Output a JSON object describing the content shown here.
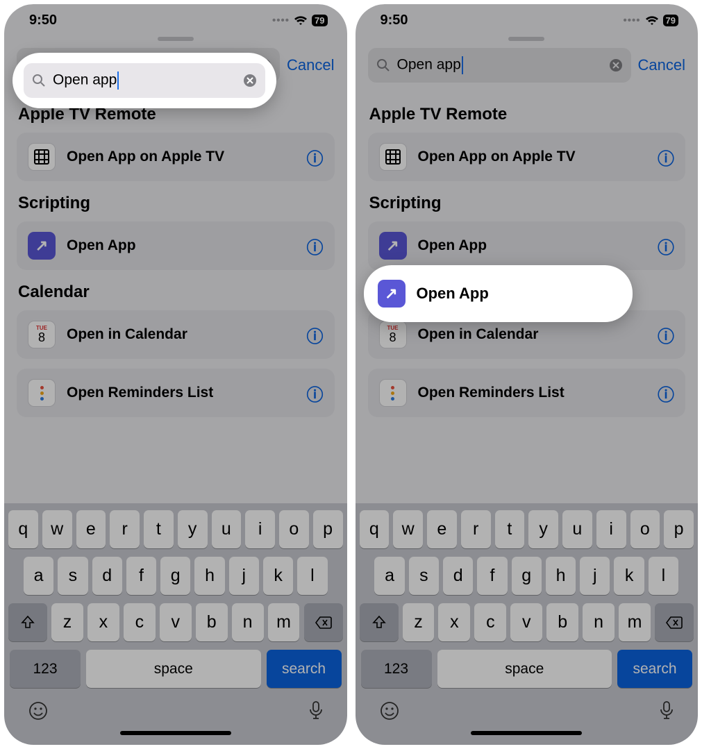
{
  "status": {
    "time": "9:50",
    "battery": "79"
  },
  "search": {
    "query": "Open app",
    "cancel": "Cancel"
  },
  "sections": {
    "atv": {
      "header": "Apple TV Remote",
      "items": [
        {
          "label": "Open App on Apple TV"
        }
      ]
    },
    "scripting": {
      "header": "Scripting",
      "items": [
        {
          "label": "Open App"
        }
      ]
    },
    "calendar": {
      "header": "Calendar",
      "items": [
        {
          "label": "Open in Calendar",
          "dayLabel": "TUE",
          "dayNum": "8"
        },
        {
          "label": "Open Reminders List"
        }
      ]
    }
  },
  "keyboard": {
    "row1": [
      "q",
      "w",
      "e",
      "r",
      "t",
      "y",
      "u",
      "i",
      "o",
      "p"
    ],
    "row2": [
      "a",
      "s",
      "d",
      "f",
      "g",
      "h",
      "j",
      "k",
      "l"
    ],
    "row3": [
      "z",
      "x",
      "c",
      "v",
      "b",
      "n",
      "m"
    ],
    "num": "123",
    "space": "space",
    "search": "search"
  }
}
